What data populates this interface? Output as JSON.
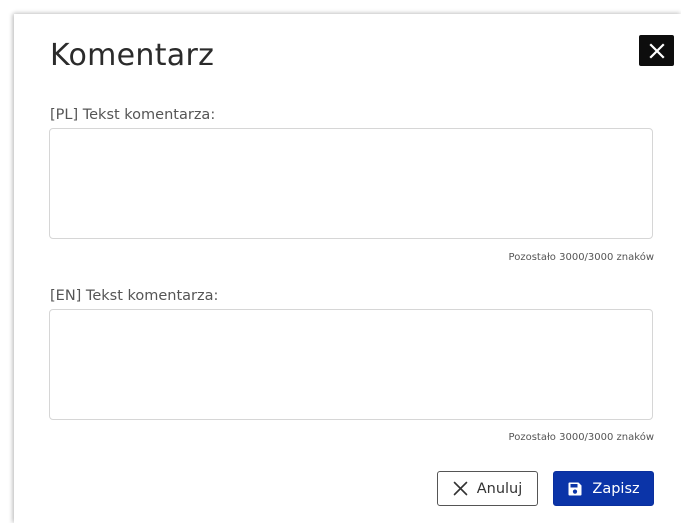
{
  "dialog": {
    "title": "Komentarz",
    "close_icon": "close-icon"
  },
  "fields": [
    {
      "label": "[PL] Tekst komentarza:",
      "value": "",
      "counter": "Pozostało 3000/3000 znaków"
    },
    {
      "label": "[EN] Tekst komentarza:",
      "value": "",
      "counter": "Pozostało 3000/3000 znaków"
    }
  ],
  "actions": {
    "cancel_label": "Anuluj",
    "cancel_icon": "close-icon",
    "save_label": "Zapisz",
    "save_icon": "floppy-disk-icon"
  },
  "colors": {
    "primary": "#0b34a8",
    "close_button": "#0d0d0d"
  }
}
